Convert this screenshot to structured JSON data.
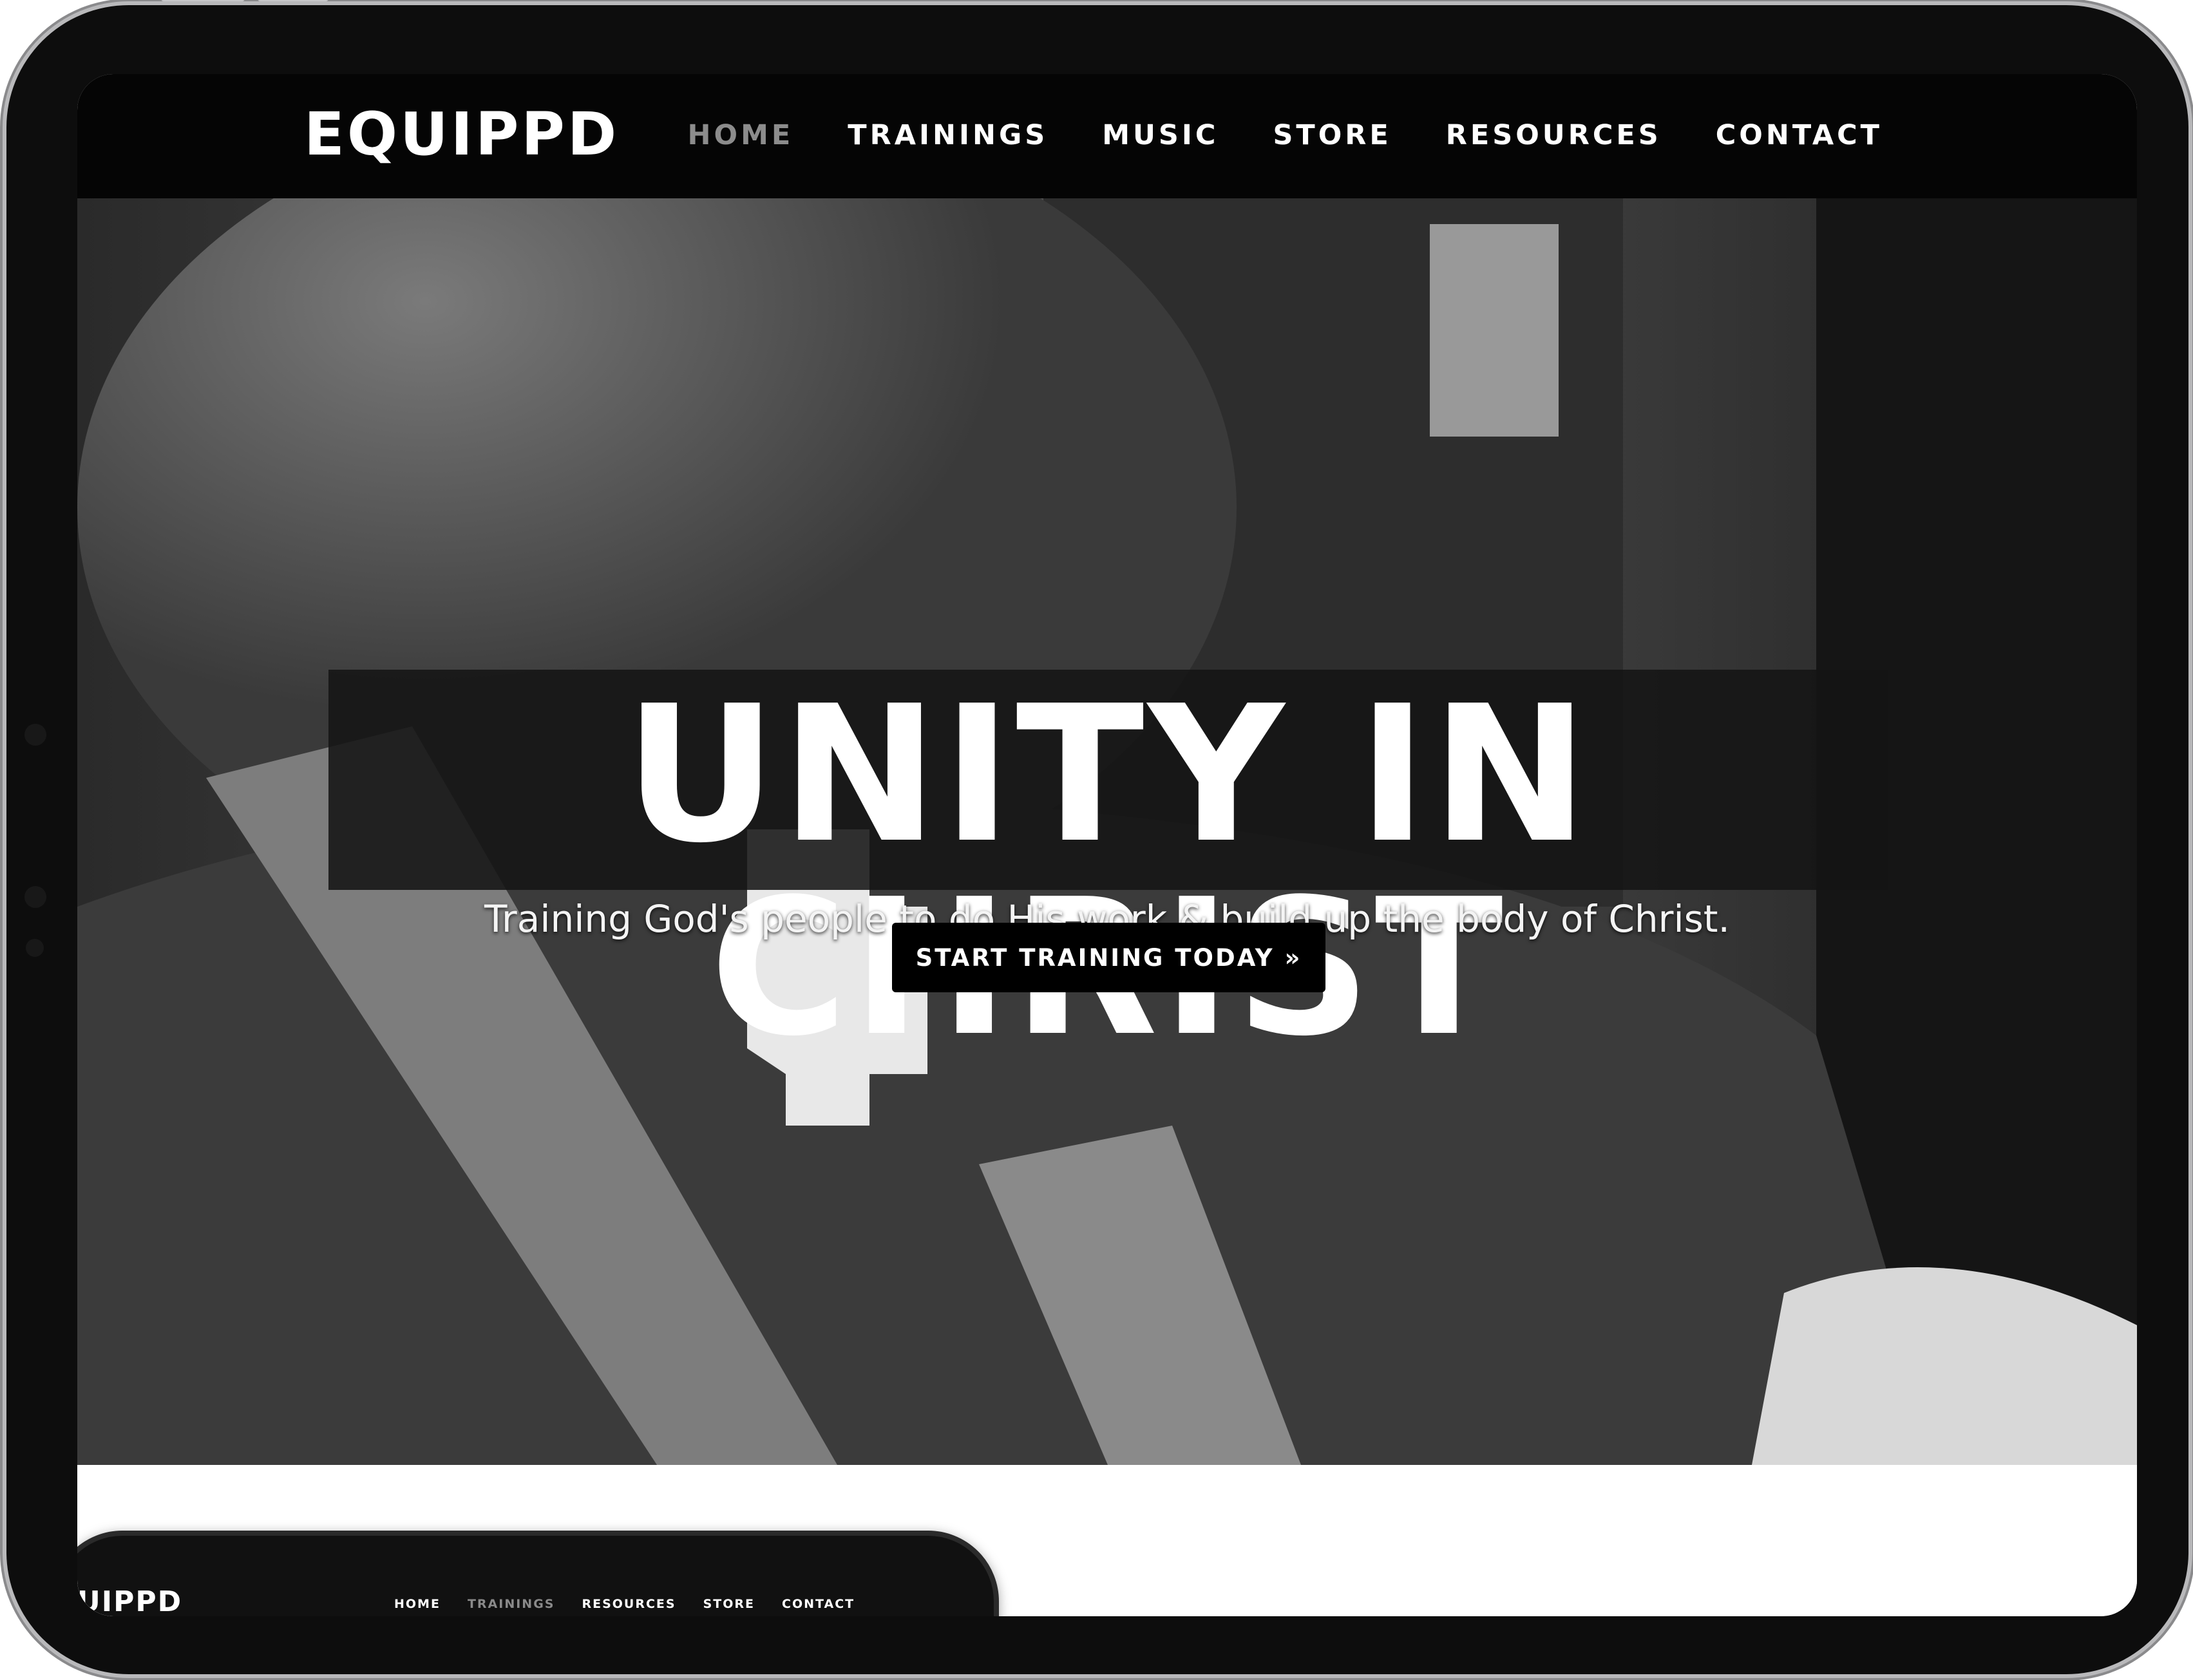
{
  "brand": {
    "logo_text": "EQUIPPD"
  },
  "nav": {
    "items": [
      {
        "label": "HOME",
        "active": true
      },
      {
        "label": "TRAININGS",
        "active": false
      },
      {
        "label": "MUSIC",
        "active": false
      },
      {
        "label": "STORE",
        "active": false
      },
      {
        "label": "RESOURCES",
        "active": false
      },
      {
        "label": "CONTACT",
        "active": false
      }
    ]
  },
  "hero": {
    "headline": "UNITY IN CHRIST",
    "subheadline": "Training God's people to do His work & build up the body of Christ.",
    "cta_label": "START TRAINING TODAY »"
  },
  "phone_preview": {
    "logo_text": "UIPPD",
    "nav_items": [
      {
        "label": "HOME"
      },
      {
        "label": "TRAININGS"
      },
      {
        "label": "RESOURCES"
      },
      {
        "label": "STORE"
      },
      {
        "label": "CONTACT"
      }
    ]
  },
  "colors": {
    "nav_bg": "#050505",
    "nav_active": "#8c8c8c",
    "text": "#ffffff",
    "cta_bg": "#000000",
    "device_frame": "#0d0d0d"
  }
}
